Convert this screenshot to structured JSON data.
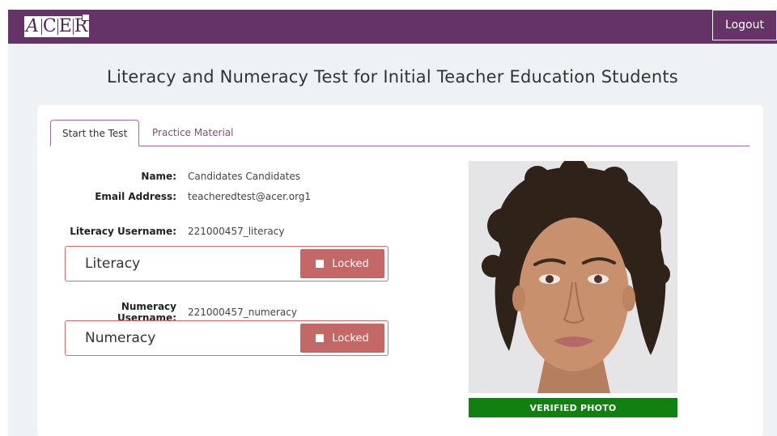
{
  "header": {
    "logo_text": "ACER",
    "logout_label": "Logout",
    "colors": {
      "bar": "#663366",
      "accent": "#a46a9a"
    }
  },
  "page": {
    "title": "Literacy and Numeracy Test for Initial Teacher Education Students"
  },
  "tabs": [
    {
      "label": "Start the Test",
      "active": true
    },
    {
      "label": "Practice Material",
      "active": false
    }
  ],
  "candidate": {
    "name_label": "Name:",
    "name_value": "Candidates Candidates",
    "email_label": "Email Address:",
    "email_value": "teacheredtest@acer.org1"
  },
  "tests": {
    "literacy": {
      "username_label": "Literacy Username:",
      "username_value": "221000457_literacy",
      "title": "Literacy",
      "status": "Locked"
    },
    "numeracy": {
      "username_label": "Numeracy Username:",
      "username_value": "221000457_numeracy",
      "title": "Numeracy",
      "status": "Locked"
    }
  },
  "photo": {
    "status": "VERIFIED PHOTO",
    "status_color": "#108010"
  }
}
